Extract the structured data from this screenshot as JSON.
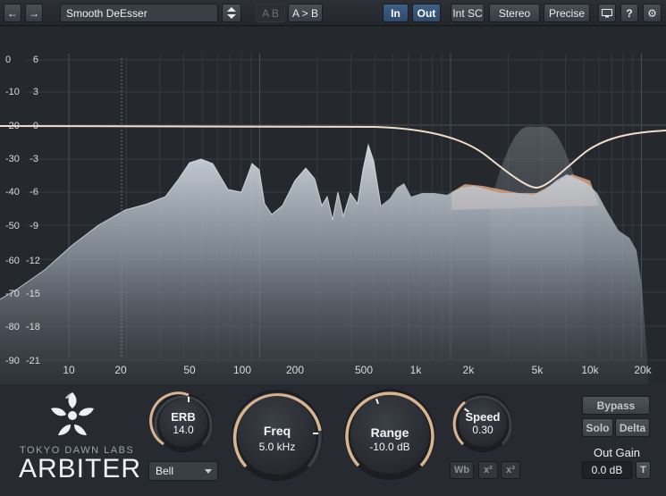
{
  "toolbar": {
    "back_icon": "arrow-left-icon",
    "forward_icon": "arrow-right-icon",
    "preset_name": "Smooth DeEsser",
    "ab_label": "A B",
    "a_to_b_label": "A > B",
    "in_label": "In",
    "out_label": "Out",
    "int_sc_label": "Int SC",
    "stereo_label": "Stereo",
    "precise_label": "Precise",
    "display_icon": "monitor-icon",
    "help_label": "?",
    "settings_icon": "gear-icon"
  },
  "analyzer": {
    "left_scale": [
      "0",
      "-10",
      "-20",
      "-30",
      "-40",
      "-50",
      "-60",
      "-70",
      "-80",
      "-90"
    ],
    "right_scale": [
      "6",
      "3",
      "0",
      "-3",
      "-6",
      "-9",
      "-12",
      "-15",
      "-18",
      "-21"
    ],
    "freq_labels": [
      "10",
      "20",
      "50",
      "100",
      "200",
      "500",
      "1k",
      "2k",
      "5k",
      "10k",
      "20k"
    ],
    "colors": {
      "spectrum": "#c6ced8",
      "reduction": "#d2a07a",
      "curve": "#f2ddc8"
    }
  },
  "brand": {
    "company": "TOKYO DAWN LABS",
    "product": "ARBITER",
    "logo_icon": "flower-logo-icon"
  },
  "controls": {
    "erb": {
      "label": "ERB",
      "value": "14.0"
    },
    "freq": {
      "label": "Freq",
      "value": "5.0 kHz"
    },
    "range": {
      "label": "Range",
      "value": "-10.0 dB"
    },
    "speed": {
      "label": "Speed",
      "value": "0.30"
    },
    "mode": "Bell",
    "wb_label": "Wb",
    "x2_label": "x²",
    "x3_label": "x³",
    "bypass_label": "Bypass",
    "solo_label": "Solo",
    "delta_label": "Delta",
    "out_gain_label": "Out Gain",
    "out_gain_value": "0.0 dB",
    "t_label": "T",
    "accent": "#d8b48f"
  }
}
